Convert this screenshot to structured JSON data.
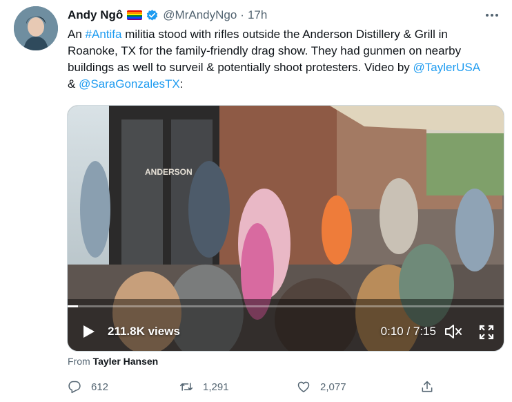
{
  "tweet": {
    "author_name": "Andy Ngô",
    "handle": "@MrAndyNgo",
    "separator": "·",
    "time": "17h",
    "text_part1": "An ",
    "hashtag": "#Antifa",
    "text_part2": " militia stood with rifles outside the Anderson Distillery & Grill in Roanoke, TX for the family-friendly drag show. They had gunmen on nearby buildings as well to surveil & potentially shoot protesters. Video by ",
    "mention1": "@TaylerUSA",
    "text_part3": " & ",
    "mention2": "@SaraGonzalesTX",
    "text_part4": ":"
  },
  "media": {
    "views": "211.8K views",
    "timecode": "0:10 / 7:15",
    "progress": 0.023,
    "sign_text": "ANDERSON"
  },
  "attribution": {
    "prefix": "From ",
    "source": "Tayler Hansen"
  },
  "actions": {
    "replies": "612",
    "retweets": "1,291",
    "likes": "2,077"
  },
  "colors": {
    "link": "#1d9bf0",
    "secondary_text": "#536471",
    "verified": "#1d9bf0"
  },
  "icons": [
    "pride-flag-icon",
    "verified-badge-icon",
    "more-icon",
    "play-icon",
    "volume-icon",
    "fullscreen-icon",
    "reply-icon",
    "retweet-icon",
    "like-icon",
    "share-icon"
  ]
}
